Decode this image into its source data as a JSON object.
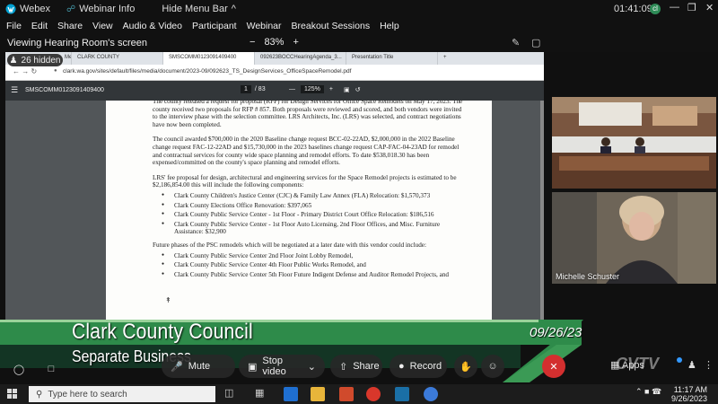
{
  "app": {
    "name": "Webex",
    "webinar_info": "Webinar Info",
    "hide_menu": "Hide Menu Bar",
    "clock": "01:41:09",
    "badge": "cl"
  },
  "menu": [
    "File",
    "Edit",
    "Share",
    "View",
    "Audio & Video",
    "Participant",
    "Webinar",
    "Breakout Sessions",
    "Help"
  ],
  "view": {
    "label": "Viewing Hearing Room's screen",
    "zoom": "83%",
    "minus": "−",
    "plus": "+"
  },
  "hidden": "26 hidden",
  "browser": {
    "tabs": [
      "Meeting...",
      "CLARK COUNTY",
      "SMSCOMM0123091409400",
      "092623BOCCHearingAgenda_3...",
      "Presentation Title"
    ],
    "url": "clark.wa.gov/sites/default/files/media/document/2023-09/092623_TS_DesignServices_OfficeSpaceRemodel.pdf",
    "pdf_name": "SMSCOMM0123091409400",
    "page_current": "1",
    "page_total": "/ 83",
    "pdf_zoom": "125%"
  },
  "document": {
    "p1": "The county released a request for proposal (RFP) for Design Services for Office Space Remodels on May 17, 2023. The county received two proposals for RFP # 857. Both proposals were reviewed and scored, and both vendors were invited to the interview phase with the selection committee. LRS Architects, Inc. (LRS) was selected, and contract negotiations have now been completed.",
    "p2": "The council awarded $700,000 in the 2020 Baseline change request BCC-02-22AD, $2,000,000 in the 2022 Baseline change request FAC-12-22AD and $15,730,000 in the 2023 baselines change request CAP-FAC-04-23AD for remodel and contractual services for county wide space planning and remodel efforts. To date $538,018.30 has been expensed/committed on the county's space planning and remodel efforts.",
    "p3": "LRS' fee proposal for design, architectural and engineering services for the Space Remodel projects is estimated to be $2,186,854.00 this will include the following components:",
    "list1": [
      "Clark County Children's Justice Center (CJC) & Family Law Annex (FLA) Relocation: $1,570,373",
      "Clark County Elections Office Renovation: $397,065",
      "Clark County Public Service Center - 1st Floor - Primary District Court Office Relocation: $186,516",
      "Clark County Public Service Center - 1st Floor Auto Licensing, 2nd Floor Offices, and Misc. Furniture Assistance: $32,900"
    ],
    "p4": "Future phases of the PSC remodels which will be negotiated at a later date with this vendor could include:",
    "list2": [
      "Clark County Public Service Center 2nd Floor Joint Lobby Remodel,",
      "Clark County Public Service Center 4th Floor Public Works Remodel, and",
      "Clark County Public Service Center 5th Floor Future Indigent Defense and Auditor Remodel Projects, and"
    ]
  },
  "participants": {
    "person2": "Michelle Schuster"
  },
  "lower_third": {
    "title": "Clark County Council",
    "subtitle": "Separate Business",
    "date": "09/26/23"
  },
  "controls": {
    "mute": "Mute",
    "stop_video": "Stop video",
    "share": "Share",
    "record": "Record",
    "apps": "Apps"
  },
  "taskbar": {
    "search_placeholder": "Type here to search",
    "time": "11:17 AM",
    "date": "9/26/2023"
  },
  "colors": {
    "lower_third_green": "#2e8b4a",
    "webex_bg": "#111111"
  }
}
